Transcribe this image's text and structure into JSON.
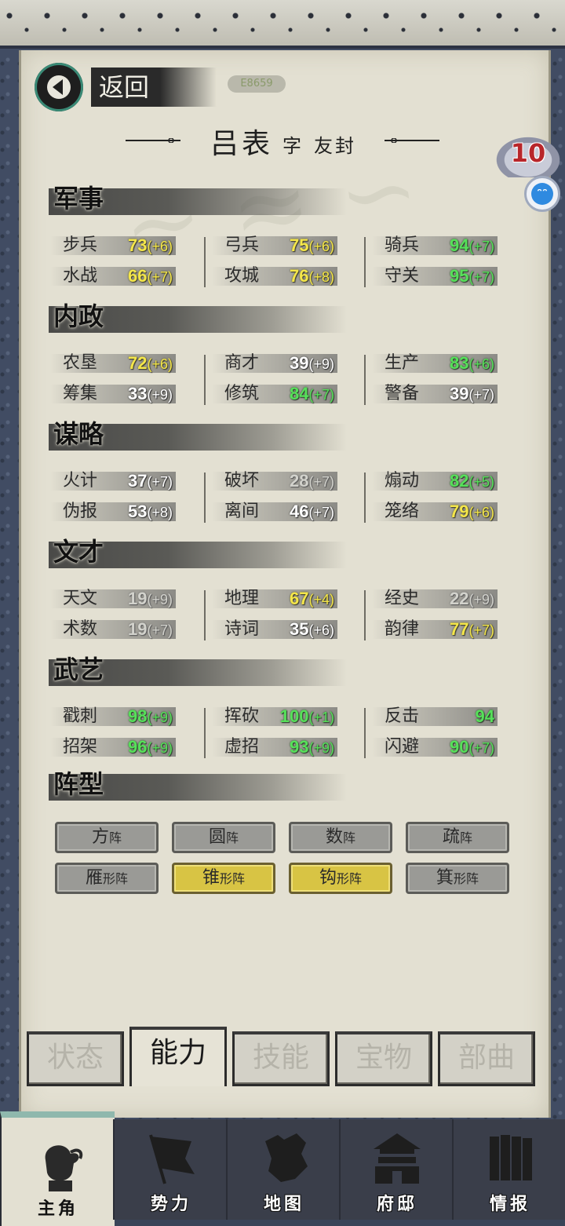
{
  "header": {
    "back_label": "返回",
    "id_badge": "E8659",
    "name": "吕表",
    "courtesy_prefix": "字",
    "courtesy_name": "友封",
    "level": "10"
  },
  "sections": [
    {
      "title": "军事",
      "stats": [
        {
          "label": "步兵",
          "value": "73",
          "bonus": "(+6)",
          "color": "yellow"
        },
        {
          "label": "水战",
          "value": "66",
          "bonus": "(+7)",
          "color": "yellow"
        },
        {
          "label": "弓兵",
          "value": "75",
          "bonus": "(+6)",
          "color": "yellow"
        },
        {
          "label": "攻城",
          "value": "76",
          "bonus": "(+8)",
          "color": "yellow"
        },
        {
          "label": "骑兵",
          "value": "94",
          "bonus": "(+7)",
          "color": "green"
        },
        {
          "label": "守关",
          "value": "95",
          "bonus": "(+7)",
          "color": "green"
        }
      ]
    },
    {
      "title": "内政",
      "stats": [
        {
          "label": "农垦",
          "value": "72",
          "bonus": "(+6)",
          "color": "yellow"
        },
        {
          "label": "筹集",
          "value": "33",
          "bonus": "(+9)",
          "color": "white"
        },
        {
          "label": "商才",
          "value": "39",
          "bonus": "(+9)",
          "color": "white"
        },
        {
          "label": "修筑",
          "value": "84",
          "bonus": "(+7)",
          "color": "green"
        },
        {
          "label": "生产",
          "value": "83",
          "bonus": "(+6)",
          "color": "green"
        },
        {
          "label": "警备",
          "value": "39",
          "bonus": "(+7)",
          "color": "white"
        }
      ]
    },
    {
      "title": "谋略",
      "stats": [
        {
          "label": "火计",
          "value": "37",
          "bonus": "(+7)",
          "color": "white"
        },
        {
          "label": "伪报",
          "value": "53",
          "bonus": "(+8)",
          "color": "white"
        },
        {
          "label": "破坏",
          "value": "28",
          "bonus": "(+7)",
          "color": "gray"
        },
        {
          "label": "离间",
          "value": "46",
          "bonus": "(+7)",
          "color": "white"
        },
        {
          "label": "煽动",
          "value": "82",
          "bonus": "(+5)",
          "color": "green"
        },
        {
          "label": "笼络",
          "value": "79",
          "bonus": "(+6)",
          "color": "yellow"
        }
      ]
    },
    {
      "title": "文才",
      "stats": [
        {
          "label": "天文",
          "value": "19",
          "bonus": "(+9)",
          "color": "gray"
        },
        {
          "label": "术数",
          "value": "19",
          "bonus": "(+7)",
          "color": "gray"
        },
        {
          "label": "地理",
          "value": "67",
          "bonus": "(+4)",
          "color": "yellow"
        },
        {
          "label": "诗词",
          "value": "35",
          "bonus": "(+6)",
          "color": "white"
        },
        {
          "label": "经史",
          "value": "22",
          "bonus": "(+9)",
          "color": "gray"
        },
        {
          "label": "韵律",
          "value": "77",
          "bonus": "(+7)",
          "color": "yellow"
        }
      ]
    },
    {
      "title": "武艺",
      "stats": [
        {
          "label": "戳刺",
          "value": "98",
          "bonus": "(+9)",
          "color": "green"
        },
        {
          "label": "招架",
          "value": "96",
          "bonus": "(+9)",
          "color": "green"
        },
        {
          "label": "挥砍",
          "value": "100",
          "bonus": "(+1)",
          "color": "green"
        },
        {
          "label": "虚招",
          "value": "93",
          "bonus": "(+9)",
          "color": "green"
        },
        {
          "label": "反击",
          "value": "94",
          "bonus": "",
          "color": "green"
        },
        {
          "label": "闪避",
          "value": "90",
          "bonus": "(+7)",
          "color": "green"
        }
      ]
    }
  ],
  "formation": {
    "title": "阵型",
    "buttons": [
      {
        "big": "方",
        "small": "阵",
        "active": false
      },
      {
        "big": "圆",
        "small": "阵",
        "active": false
      },
      {
        "big": "数",
        "small": "阵",
        "active": false
      },
      {
        "big": "疏",
        "small": "阵",
        "active": false
      },
      {
        "big": "雁",
        "small": "形阵",
        "active": false
      },
      {
        "big": "锥",
        "small": "形阵",
        "active": true
      },
      {
        "big": "钩",
        "small": "形阵",
        "active": true
      },
      {
        "big": "箕",
        "small": "形阵",
        "active": false
      }
    ]
  },
  "tabs": [
    {
      "label": "状态",
      "active": false
    },
    {
      "label": "能力",
      "active": true
    },
    {
      "label": "技能",
      "active": false
    },
    {
      "label": "宝物",
      "active": false
    },
    {
      "label": "部曲",
      "active": false
    }
  ],
  "bottom_nav": [
    {
      "label": "主角",
      "icon": "general-portrait-icon",
      "active": true
    },
    {
      "label": "势力",
      "icon": "flag-icon",
      "active": false
    },
    {
      "label": "地图",
      "icon": "map-icon",
      "active": false
    },
    {
      "label": "府邸",
      "icon": "mansion-icon",
      "active": false
    },
    {
      "label": "情报",
      "icon": "scroll-icon",
      "active": false
    }
  ],
  "colors": {
    "yellow": "#f4e64a",
    "green": "#57e05a",
    "white": "#ffffff",
    "gray": "#d2d2cc",
    "active_formation": "#d8c444"
  }
}
